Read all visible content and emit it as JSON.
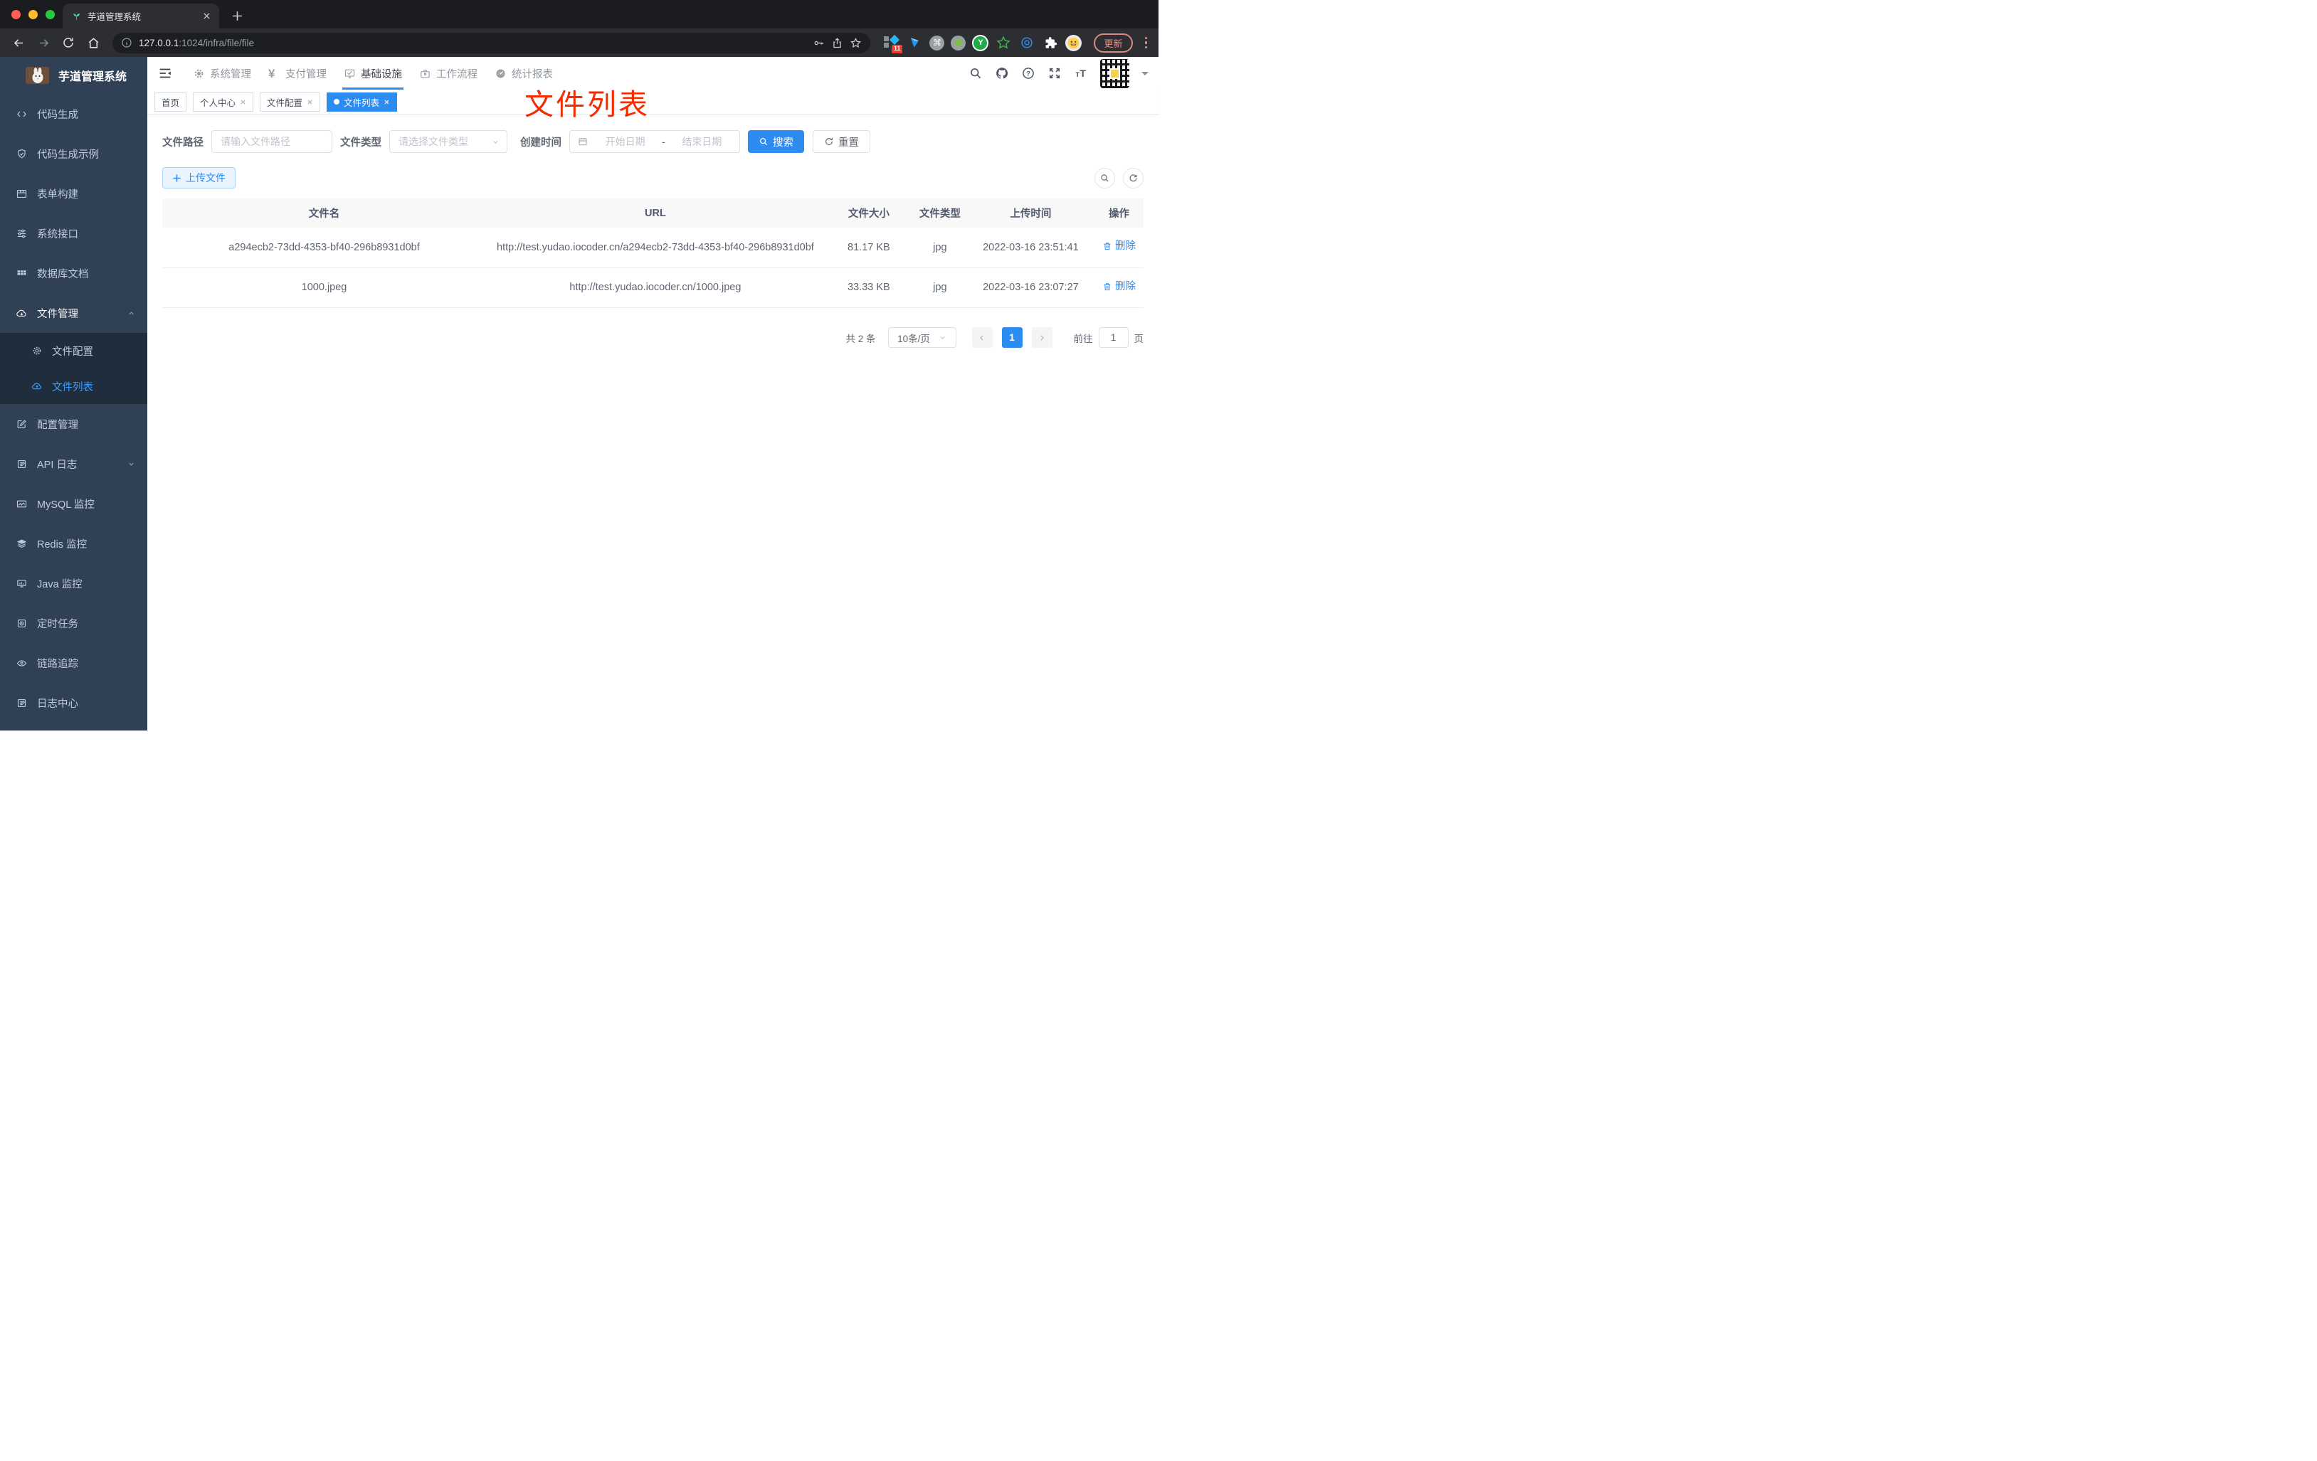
{
  "browser": {
    "tab_title": "芋道管理系统",
    "url_host": "127.0.0.1",
    "url_rest": ":1024/infra/file/file",
    "extension_badge": "11",
    "update_label": "更新"
  },
  "icons": {
    "yen": "¥",
    "cmd": "⌘",
    "ext_y": "Y",
    "help": "?",
    "font_big": "T",
    "font_small": "T"
  },
  "sidebar": {
    "app_title": "芋道管理系统",
    "items": [
      {
        "label": "代码生成",
        "icon": "code-icon"
      },
      {
        "label": "代码生成示例",
        "icon": "shield-check-icon"
      },
      {
        "label": "表单构建",
        "icon": "form-icon"
      },
      {
        "label": "系统接口",
        "icon": "sliders-icon"
      },
      {
        "label": "数据库文档",
        "icon": "table-grid-icon"
      },
      {
        "label": "文件管理",
        "icon": "cloud-download-icon",
        "expanded": true
      }
    ],
    "submenu": [
      {
        "label": "文件配置",
        "icon": "gear-icon"
      },
      {
        "label": "文件列表",
        "icon": "cloud-upload-icon",
        "active": true
      }
    ],
    "items_lower": [
      {
        "label": "配置管理",
        "icon": "edit-square-icon"
      },
      {
        "label": "API 日志",
        "icon": "doc-edit-icon",
        "collapsed": true
      },
      {
        "label": "MySQL 监控",
        "icon": "chart-line-icon"
      },
      {
        "label": "Redis 监控",
        "icon": "layers-icon"
      },
      {
        "label": "Java 监控",
        "icon": "monitor-bars-icon"
      },
      {
        "label": "定时任务",
        "icon": "doc-clock-icon"
      },
      {
        "label": "链路追踪",
        "icon": "eye-icon"
      },
      {
        "label": "日志中心",
        "icon": "doc-edit-icon"
      }
    ]
  },
  "topnav": {
    "items": [
      {
        "label": "系统管理",
        "icon": "gear-icon"
      },
      {
        "label": "支付管理",
        "icon": "yen-icon"
      },
      {
        "label": "基础设施",
        "icon": "monitor-check-icon",
        "active": true
      },
      {
        "label": "工作流程",
        "icon": "briefcase-icon"
      },
      {
        "label": "统计报表",
        "icon": "gauge-icon"
      }
    ]
  },
  "tabs": [
    {
      "label": "首页",
      "closable": false
    },
    {
      "label": "个人中心",
      "closable": true
    },
    {
      "label": "文件配置",
      "closable": true
    },
    {
      "label": "文件列表",
      "closable": true,
      "active": true
    }
  ],
  "annotation": {
    "text": "文件列表"
  },
  "filter": {
    "path_label": "文件路径",
    "path_placeholder": "请输入文件路径",
    "type_label": "文件类型",
    "type_placeholder": "请选择文件类型",
    "time_label": "创建时间",
    "start_placeholder": "开始日期",
    "separator": "-",
    "end_placeholder": "结束日期",
    "search_label": "搜索",
    "reset_label": "重置"
  },
  "toolbar": {
    "upload_label": "上传文件"
  },
  "table": {
    "columns": [
      "文件名",
      "URL",
      "文件大小",
      "文件类型",
      "上传时间",
      "操作"
    ],
    "rows": [
      {
        "name": "a294ecb2-73dd-4353-bf40-296b8931d0bf",
        "url": "http://test.yudao.iocoder.cn/a294ecb2-73dd-4353-bf40-296b8931d0bf",
        "size": "81.17 KB",
        "type": "jpg",
        "time": "2022-03-16 23:51:41",
        "action": "删除"
      },
      {
        "name": "1000.jpeg",
        "url": "http://test.yudao.iocoder.cn/1000.jpeg",
        "size": "33.33 KB",
        "type": "jpg",
        "time": "2022-03-16 23:07:27",
        "action": "删除"
      }
    ]
  },
  "pagination": {
    "total": "共 2 条",
    "page_size": "10条/页",
    "current": "1",
    "goto_label": "前往",
    "goto_value": "1",
    "page_label": "页"
  },
  "colors": {
    "primary": "#2d8cf0",
    "sidebar_bg": "#304156",
    "submenu_bg": "#1f2d3d",
    "sidebar_text": "#bfcbd9",
    "active_link": "#409eff",
    "annotation_red": "#f62c00"
  }
}
